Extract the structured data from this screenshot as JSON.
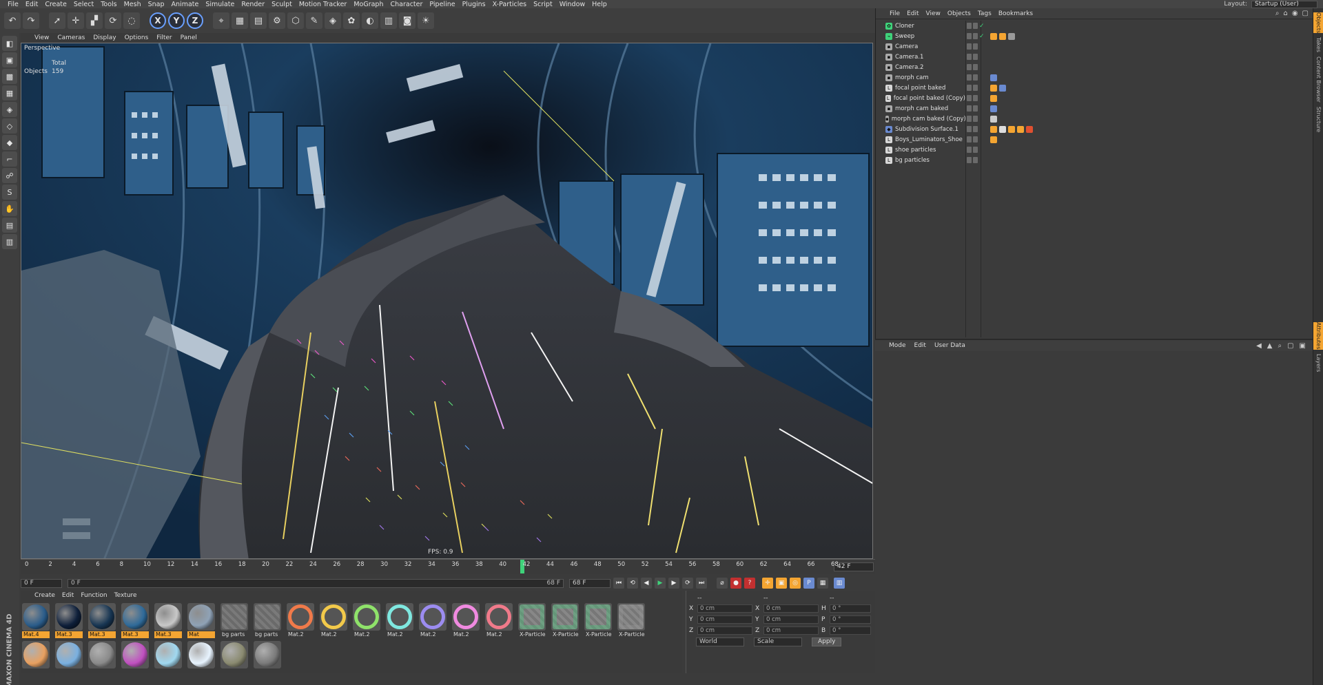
{
  "menubar": [
    "File",
    "Edit",
    "Create",
    "Select",
    "Tools",
    "Mesh",
    "Snap",
    "Animate",
    "Simulate",
    "Render",
    "Sculpt",
    "Motion Tracker",
    "MoGraph",
    "Character",
    "Pipeline",
    "Plugins",
    "X-Particles",
    "Script",
    "Window",
    "Help"
  ],
  "layout": {
    "label": "Layout:",
    "value": "Startup (User)"
  },
  "toolbar": {
    "icons": [
      "undo-icon",
      "redo-icon",
      "select-arrow-icon",
      "move-icon",
      "scale-icon",
      "rotate-icon",
      "live-selection-icon"
    ],
    "axes": [
      "X",
      "Y",
      "Z"
    ],
    "tools": [
      "coordinate-system-icon",
      "render-view-icon",
      "render-picture-viewer-icon",
      "render-settings-icon",
      "cube-icon",
      "pen-spline-icon",
      "subdivision-icon",
      "cloner-icon",
      "deformer-icon",
      "floor-icon",
      "camera-icon",
      "light-icon"
    ]
  },
  "viewport": {
    "menu": [
      "View",
      "Cameras",
      "Display",
      "Options",
      "Filter",
      "Panel"
    ],
    "label": "Perspective",
    "stats_header": "Total",
    "stats_label": "Objects",
    "stats_value": "159",
    "fps": "FPS: 0.9"
  },
  "timeline": {
    "ticks": [
      "0",
      "2",
      "4",
      "6",
      "8",
      "10",
      "12",
      "14",
      "16",
      "18",
      "20",
      "22",
      "24",
      "26",
      "28",
      "30",
      "32",
      "34",
      "36",
      "38",
      "40",
      "42",
      "44",
      "46",
      "48",
      "50",
      "52",
      "54",
      "56",
      "58",
      "60",
      "62",
      "64",
      "66",
      "68"
    ],
    "current": "42",
    "frame_display": "42 F"
  },
  "transport": {
    "start": "0 F",
    "range_left": "0 F",
    "range_right": "68 F",
    "end": "68 F"
  },
  "materials": {
    "menu": [
      "Create",
      "Edit",
      "Function",
      "Texture"
    ],
    "items": [
      {
        "name": "Mat.4",
        "color": "#2a5c8a",
        "labeled": true
      },
      {
        "name": "Mat.3",
        "color": "#0e1f3a",
        "labeled": true
      },
      {
        "name": "Mat.3",
        "color": "#173552",
        "labeled": true
      },
      {
        "name": "Mat.3",
        "color": "#2f6a99",
        "labeled": true
      },
      {
        "name": "Mat.3",
        "color": "#c8c8c8",
        "labeled": true
      },
      {
        "name": "Mat",
        "color": "#8fa2b6",
        "labeled": true
      },
      {
        "name": "bg parts",
        "color": "#7a7fa0",
        "labeled": false
      },
      {
        "name": "bg parts",
        "color": "#7a7fa0",
        "labeled": false
      },
      {
        "name": "Mat.2",
        "color": "#f07a4a",
        "labeled": false
      },
      {
        "name": "Mat.2",
        "color": "#f2c94a",
        "labeled": false
      },
      {
        "name": "Mat.2",
        "color": "#8fe26a",
        "labeled": false
      },
      {
        "name": "Mat.2",
        "color": "#7fe8e0",
        "labeled": false
      },
      {
        "name": "Mat.2",
        "color": "#9c8cf0",
        "labeled": false
      },
      {
        "name": "Mat.2",
        "color": "#f08ae0",
        "labeled": false
      },
      {
        "name": "Mat.2",
        "color": "#f07a8a",
        "labeled": false
      },
      {
        "name": "X-Particles",
        "color": "#3fd27a",
        "labeled": false
      },
      {
        "name": "X-Particles",
        "color": "#3fd27a",
        "labeled": false
      },
      {
        "name": "X-Particles",
        "color": "#3fd27a",
        "labeled": false
      },
      {
        "name": "X-Particles",
        "color": "#9a9a9a",
        "labeled": false
      }
    ],
    "row2": [
      "#e8a060",
      "#7ab0e0",
      "#8a8a8a",
      "#c050c0",
      "#a0d8f0",
      "#e8f4ff",
      "#8a8a70",
      "#7a7a7a"
    ]
  },
  "coords": {
    "header": [
      "--",
      "--",
      "--"
    ],
    "rows": [
      {
        "a": "X",
        "v1": "0 cm",
        "b": "X",
        "v2": "0 cm",
        "c": "H",
        "v3": "0 °"
      },
      {
        "a": "Y",
        "v1": "0 cm",
        "b": "Y",
        "v2": "0 cm",
        "c": "P",
        "v3": "0 °"
      },
      {
        "a": "Z",
        "v1": "0 cm",
        "b": "Z",
        "v2": "0 cm",
        "c": "B",
        "v3": "0 °"
      }
    ],
    "mode1": "World",
    "mode2": "Scale",
    "apply": "Apply"
  },
  "objects": {
    "menu": [
      "File",
      "Edit",
      "View",
      "Objects",
      "Tags",
      "Bookmarks"
    ],
    "items": [
      {
        "name": "Cloner",
        "icon": "#3fd27a",
        "glyph": "✿",
        "green": true,
        "tags": []
      },
      {
        "name": "Sweep",
        "icon": "#3fd27a",
        "glyph": "⌁",
        "green": true,
        "tags": [
          "#f4a532",
          "#f4a532",
          "#9a9a9a"
        ]
      },
      {
        "name": "Camera",
        "icon": "#aaaaaa",
        "glyph": "▪",
        "green": false,
        "tags": []
      },
      {
        "name": "Camera.1",
        "icon": "#aaaaaa",
        "glyph": "▪",
        "green": false,
        "tags": []
      },
      {
        "name": "Camera.2",
        "icon": "#aaaaaa",
        "glyph": "▪",
        "green": false,
        "tags": []
      },
      {
        "name": "morph cam",
        "icon": "#aaaaaa",
        "glyph": "▪",
        "green": false,
        "tags": [
          "#6a8ad0"
        ]
      },
      {
        "name": "focal point baked",
        "icon": "#d8d8d8",
        "glyph": "L",
        "green": false,
        "tags": [
          "#f4a532",
          "#6a8ad0"
        ]
      },
      {
        "name": "focal point baked (Copy)",
        "icon": "#d8d8d8",
        "glyph": "L",
        "green": false,
        "tags": [
          "#f4a532"
        ]
      },
      {
        "name": "morph cam baked",
        "icon": "#aaaaaa",
        "glyph": "▪",
        "green": false,
        "tags": [
          "#6a8ad0"
        ]
      },
      {
        "name": "morph cam baked (Copy)",
        "icon": "#aaaaaa",
        "glyph": "▪",
        "green": false,
        "tags": [
          "#cccccc"
        ]
      },
      {
        "name": "Subdivision Surface.1",
        "icon": "#6a8ad0",
        "glyph": "◆",
        "green": false,
        "tags": [
          "#f4a532",
          "#dddddd",
          "#f4a532",
          "#f4a532",
          "#e05030"
        ]
      },
      {
        "name": "Boys_Luminators_Shoe",
        "icon": "#d8d8d8",
        "glyph": "L",
        "green": false,
        "tags": [
          "#f4a532"
        ]
      },
      {
        "name": "shoe particles",
        "icon": "#d8d8d8",
        "glyph": "L",
        "green": false,
        "tags": []
      },
      {
        "name": "bg particles",
        "icon": "#d8d8d8",
        "glyph": "L",
        "green": false,
        "tags": []
      }
    ]
  },
  "attributes": {
    "menu": [
      "Mode",
      "Edit",
      "User Data"
    ]
  },
  "side_tabs": {
    "top": [
      "Objects",
      "Takes",
      "Content Browser",
      "Structure"
    ],
    "bottom": [
      "Attributes",
      "Layers"
    ]
  },
  "maxon": "MAXON CINEMA 4D"
}
